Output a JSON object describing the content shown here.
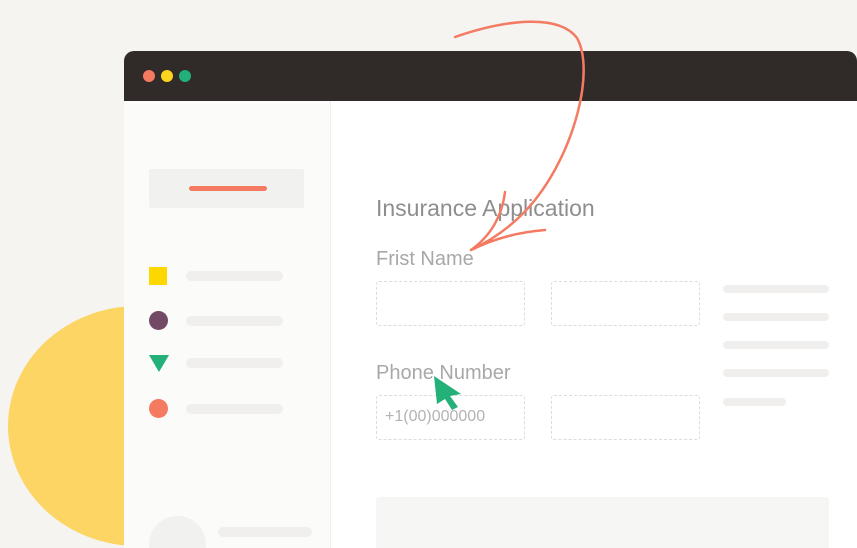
{
  "window": {
    "controls": [
      "close",
      "minimize",
      "maximize"
    ]
  },
  "form": {
    "title": "Insurance Application",
    "first_name_label": "Frist Name",
    "phone_label": "Phone Number",
    "phone_placeholder": "+1(00)000000"
  },
  "icons": {
    "sidebar": [
      "square-icon",
      "circle-icon",
      "triangle-icon",
      "circle-icon"
    ],
    "cursor": "cursor-arrow-icon",
    "annotation": "curved-arrow-icon"
  },
  "colors": {
    "accent": "#f47a62",
    "yellow": "#fcd800",
    "green": "#23b079",
    "purple": "#724a65",
    "titlebar": "#302a28",
    "blob": "#fcd565"
  }
}
